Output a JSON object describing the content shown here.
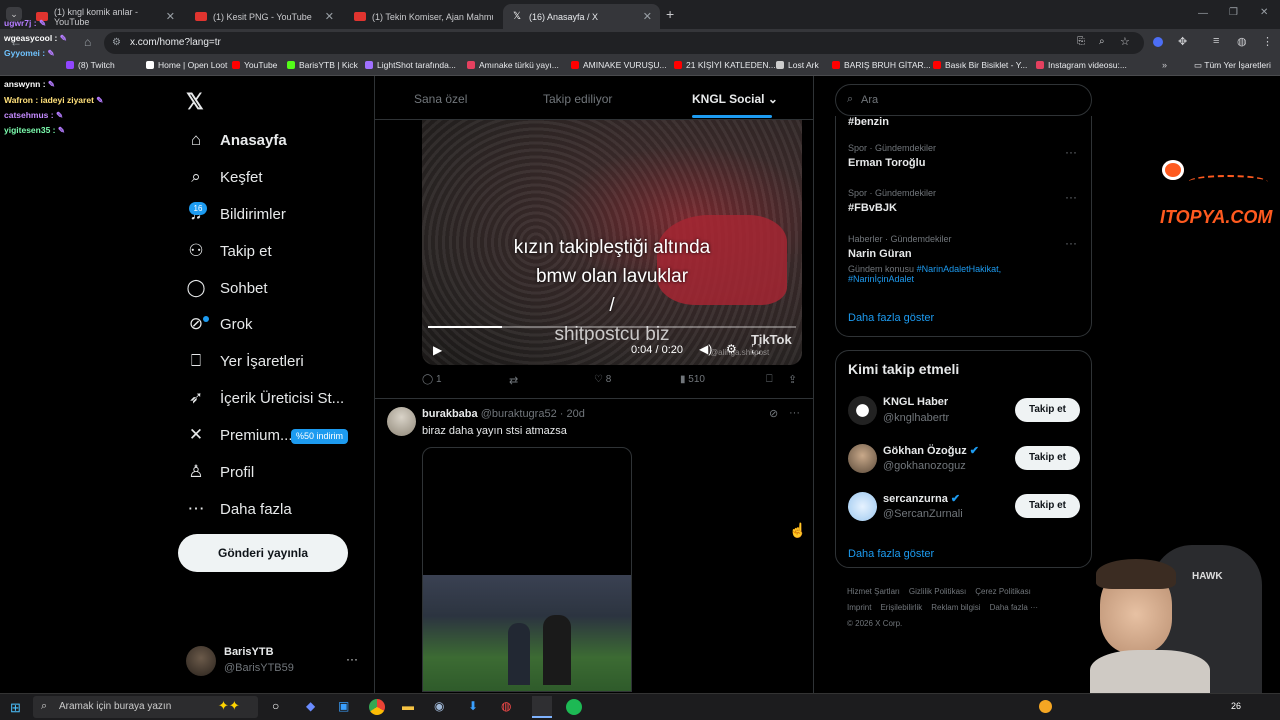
{
  "browser": {
    "tabs": [
      {
        "title": "(1) kngl komik anlar - YouTube",
        "active": false
      },
      {
        "title": "(1) Kesit PNG - YouTube",
        "active": false
      },
      {
        "title": "(1) Tekin Komiser, Ajan Mahmut",
        "active": false
      },
      {
        "title": "(16) Anasayfa / X",
        "active": true
      }
    ],
    "new_tab": "+",
    "url": "x.com/home?lang=tr",
    "bookmarks": [
      {
        "label": "(8) Twitch",
        "color": "#9146ff"
      },
      {
        "label": "Home | Open Loot",
        "color": "#ffffff"
      },
      {
        "label": "YouTube",
        "color": "#ff0000"
      },
      {
        "label": "BarisYTB | Kick",
        "color": "#53fc18"
      },
      {
        "label": "LightShot tarafında...",
        "color": "#a070ff"
      },
      {
        "label": "Amınake türkü yayı...",
        "color": "#e4405f"
      },
      {
        "label": "AMINAKE VURUŞU...",
        "color": "#ff0000"
      },
      {
        "label": "21 KİŞİYİ KATLEDEN...",
        "color": "#ff0000"
      },
      {
        "label": "Lost Ark",
        "color": "#cccccc"
      },
      {
        "label": "BARIŞ BRUH GİTAR...",
        "color": "#ff0000"
      },
      {
        "label": "Basık Bir Bisiklet - Y...",
        "color": "#ff0000"
      },
      {
        "label": "Instagram videosu:...",
        "color": "#e4405f"
      }
    ],
    "all_bookmarks": "Tüm Yer İşaretleri"
  },
  "chat": [
    {
      "user": "ugwr7j :",
      "color": "#b57cff"
    },
    {
      "user": "wgeasycool :",
      "color": "#ffffff"
    },
    {
      "user": "Gyyomei :",
      "color": "#6fc3ff"
    },
    {
      "user": "answynn :",
      "color": "#ffffff"
    },
    {
      "user": "Wafron : iadeyi ziyaret",
      "color": "#ffe07a"
    },
    {
      "user": "catsehmus :",
      "color": "#c58bff"
    },
    {
      "user": "yigitesen35 :",
      "color": "#7dffb0"
    }
  ],
  "nav": {
    "items": [
      {
        "label": "Anasayfa",
        "icon": "home-icon",
        "glyph": "⌂"
      },
      {
        "label": "Keşfet",
        "icon": "search-icon",
        "glyph": "⌕"
      },
      {
        "label": "Bildirimler",
        "icon": "bell-icon",
        "glyph": "♫"
      },
      {
        "label": "Takip et",
        "icon": "add-user-icon",
        "glyph": "⚇"
      },
      {
        "label": "Sohbet",
        "icon": "chat-icon",
        "glyph": "◯"
      },
      {
        "label": "Grok",
        "icon": "grok-icon",
        "glyph": "⊘"
      },
      {
        "label": "Yer İşaretleri",
        "icon": "bookmark-icon",
        "glyph": "⎕"
      },
      {
        "label": "İçerik Üreticisi St...",
        "icon": "rocket-icon",
        "glyph": "➶"
      },
      {
        "label": "Premium...",
        "icon": "x-premium-icon",
        "glyph": "✕"
      },
      {
        "label": "Profil",
        "icon": "profile-icon",
        "glyph": "♙"
      },
      {
        "label": "Daha fazla",
        "icon": "more-icon",
        "glyph": "⋯"
      }
    ],
    "notif_badge": "16",
    "premium_badge": "%50 indirim",
    "post_button": "Gönderi yayınla",
    "account_name": "BarisYTB",
    "account_handle": "@BarisYTB59",
    "account_more": "···"
  },
  "feed": {
    "tabs": [
      "Sana özel",
      "Takip ediliyor",
      "KNGL Social"
    ],
    "video": {
      "caption_line1": "kızın takipleştiği altında",
      "caption_line2": "bmw olan lavuklar",
      "caption_line3": "/",
      "caption_line4": "shitpostcu biz",
      "watermark": "TikTok",
      "watermark_handle": "@alinga.shitpost",
      "time": "0:04 / 0:20",
      "progress": 0.2
    },
    "actions": {
      "replies": "1",
      "reposts": "",
      "likes": "8",
      "views": "510"
    },
    "post2": {
      "author": "burakbaba",
      "handle": "@buraktugra52",
      "age": "· 20d",
      "text": "biraz daha yayın stsi atmazsa",
      "more": "···"
    }
  },
  "search": {
    "placeholder": "Ara"
  },
  "trends": {
    "top_partial": "#benzin",
    "items": [
      {
        "category": "Spor · Gündemdekiler",
        "name": "Erman Toroğlu"
      },
      {
        "category": "Spor · Gündemdekiler",
        "name": "#FBvBJK"
      },
      {
        "category": "Haberler · Gündemdekiler",
        "name": "Narin Güran",
        "topic": "Gündem konusu",
        "tags": "#NarinAdaletHakikat,",
        "tags2": "#NarinİçinAdalet"
      }
    ],
    "more": "Daha fazla göster"
  },
  "who_to_follow": {
    "title": "Kimi takip etmeli",
    "items": [
      {
        "name": "KNGL Haber",
        "handle": "@knglhabertr",
        "verified": false,
        "button": "Takip et"
      },
      {
        "name": "Gökhan Özoğuz",
        "handle": "@gokhanozoguz",
        "verified": true,
        "button": "Takip et"
      },
      {
        "name": "sercanzurna",
        "handle": "@SercanZurnali",
        "verified": true,
        "button": "Takip et"
      }
    ],
    "more": "Daha fazla göster"
  },
  "footer": {
    "links": [
      "Hizmet Şartları",
      "Gizlilik Politikası",
      "Çerez Politikası",
      "Imprint",
      "Erişilebilirlik",
      "Reklam bilgisi",
      "Daha fazla ···"
    ],
    "copyright": "© 2026 X Corp."
  },
  "overlay": {
    "itopya": "ITOPYA.COM",
    "chair_brand": "HAWK"
  },
  "taskbar": {
    "search_placeholder": "Aramak için buraya yazın",
    "clock": "26"
  },
  "colors": {
    "accent": "#1d9bf0",
    "premium": "#1d9bf0",
    "bg": "#000000"
  }
}
